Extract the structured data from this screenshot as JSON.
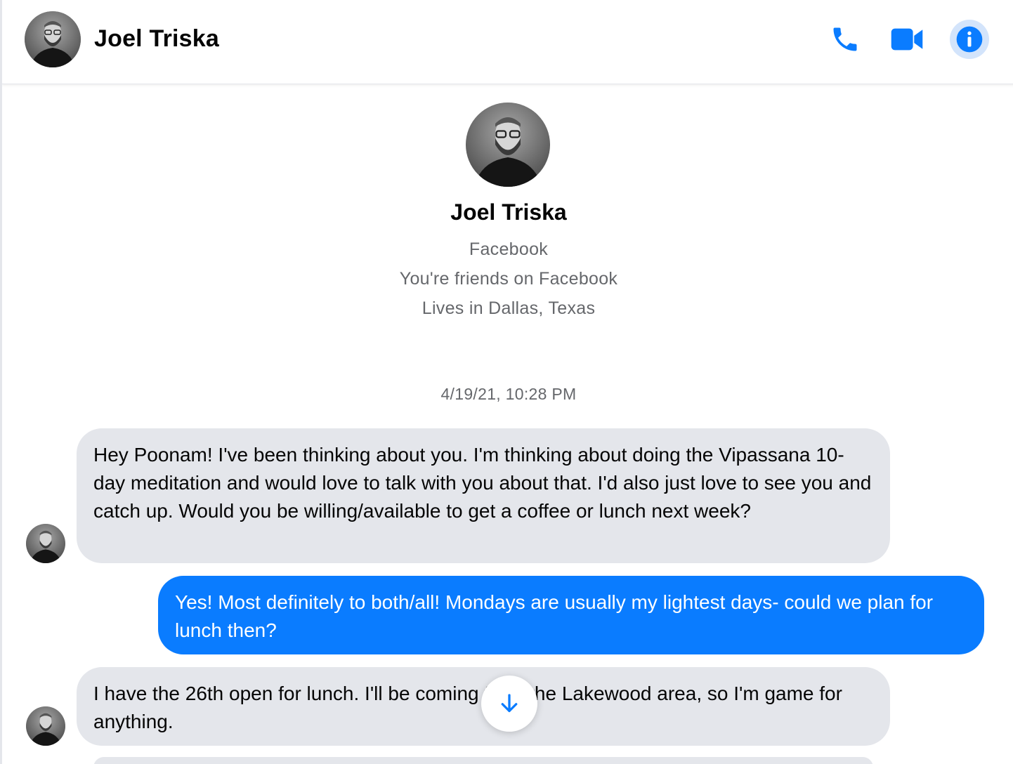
{
  "header": {
    "contact_name": "Joel Triska",
    "actions": [
      "phone-icon",
      "video-camera-icon",
      "info-icon"
    ]
  },
  "profile": {
    "name": "Joel Triska",
    "source": "Facebook",
    "relationship": "You're friends on Facebook",
    "location": "Lives in Dallas, Texas"
  },
  "thread": {
    "timestamp": "4/19/21, 10:28 PM",
    "messages": [
      {
        "sender": "contact",
        "text": "Hey Poonam! I've been thinking about you. I'm thinking about doing the Vipassana 10-day meditation and would love to talk with you about that. I'd also just love to see you and catch up. Would you be willing/available to get a coffee or lunch next week?"
      },
      {
        "sender": "me",
        "text": "Yes! Most definitely to both/all! Mondays are usually my lightest days- could we plan for lunch then?"
      },
      {
        "sender": "contact",
        "text": "I have the 26th open for lunch. I'll be coming from the Lakewood area, so I'm game for anything."
      }
    ]
  },
  "scroll_down": {
    "icon": "arrow-down-icon"
  },
  "colors": {
    "accent": "#0a7cff",
    "incoming_bubble": "#e4e6eb",
    "secondary_text": "#65676b",
    "info_button_bg": "#d3e4fb"
  }
}
